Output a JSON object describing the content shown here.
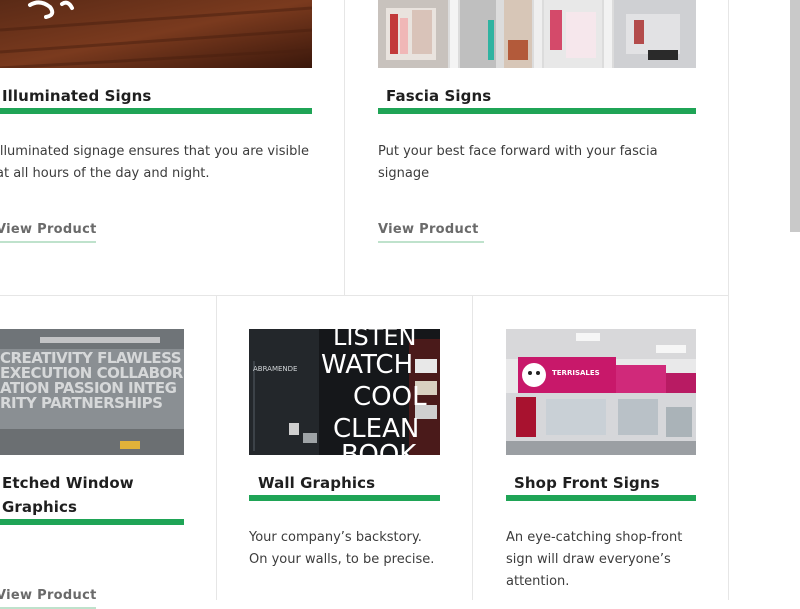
{
  "products": [
    {
      "title": "Illuminated Signs",
      "description": "Illuminated signage ensures that you are visible at all hours of the day and night.",
      "link": "View Product"
    },
    {
      "title": "Fascia Signs",
      "description": "Put your best face forward with your fascia signage",
      "link": "View Product"
    },
    {
      "title": "Etched Window Graphics",
      "image_text": "CREATIVITY FLAWLESS EXECUTION COLLABORATION PASSION INTEGRITY PARTNERSHIPS",
      "link": "View Product"
    },
    {
      "title": "Wall Graphics",
      "description": "Your company’s backstory. On your walls, to be precise.",
      "image_text": {
        "brand": "ABRAMENDE",
        "words": [
          "LISTEN",
          "WATCH",
          "COOL",
          "CLEAN",
          "BOOK"
        ]
      }
    },
    {
      "title": "Shop Front Signs",
      "description": "An eye-catching shop-front sign will draw everyone’s attention.",
      "image_text": {
        "store_name": "TERRISALES"
      }
    }
  ],
  "colors": {
    "accent": "#1fa456",
    "link": "#6a6a6a",
    "border": "#e6e6e6"
  }
}
